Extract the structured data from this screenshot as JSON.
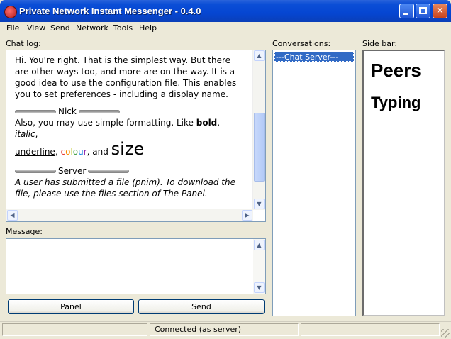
{
  "window": {
    "title": "Private Network Instant Messenger - 0.4.0",
    "minimize_glyph": "_",
    "close_glyph": "✕"
  },
  "menu": [
    "File",
    "View",
    "Send",
    "Network",
    "Tools",
    "Help"
  ],
  "labels": {
    "chat_log": "Chat log:",
    "message": "Message:",
    "conversations": "Conversations:",
    "side_bar": "Side bar:"
  },
  "chat": {
    "intro": "Hi. You're right. That is the simplest way. But there are other ways too, and more are on the way. It is a good idea to use the configuration file. This enables you to set preferences - including a display name.",
    "nick_name": "Nick",
    "formatting_prefix": "Also, you may use simple formatting. Like ",
    "bold": "bold",
    "comma1": ", ",
    "italic": "italic",
    "comma2": ",",
    "underline": "underline",
    "comma3": ", ",
    "colour_letters": [
      "c",
      "o",
      "l",
      "o",
      "u",
      "r"
    ],
    "colour_colors": [
      "#e53935",
      "#fb8c00",
      "#c0ca33",
      "#43a047",
      "#1e88e5",
      "#8e24aa"
    ],
    "and_text": ", and ",
    "size": "size",
    "server_name": "Server",
    "server_message": "A user has submitted a file (pnim). To download the file, please use the files section of The Panel."
  },
  "conversations": [
    "---Chat Server---"
  ],
  "sidebar": {
    "peers": "Peers",
    "typing": "Typing"
  },
  "buttons": {
    "panel": "Panel",
    "send": "Send"
  },
  "message_input": "",
  "status": "Connected (as server)",
  "scroll": {
    "up": "▲",
    "down": "▼",
    "left": "◀",
    "right": "▶"
  }
}
